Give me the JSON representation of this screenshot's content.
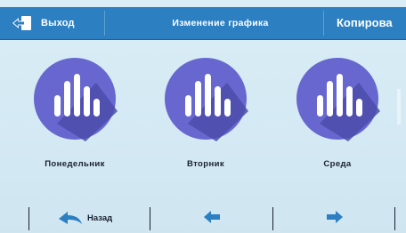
{
  "header": {
    "exit_label": "Выход",
    "title": "Изменение графика",
    "copy_label": "Копирова"
  },
  "days": [
    {
      "label": "Понедельник",
      "icon": "bar-chart-icon"
    },
    {
      "label": "Вторник",
      "icon": "bar-chart-icon"
    },
    {
      "label": "Среда",
      "icon": "bar-chart-icon"
    }
  ],
  "footer": {
    "back_label": "Назад",
    "prev_icon": "arrow-left-icon",
    "next_icon": "arrow-right-icon"
  },
  "colors": {
    "header_bg": "#2c7fc1",
    "circle_main": "#6767cf",
    "circle_shadow": "#4c4caa",
    "background": "#d6ebf4",
    "arrow_blue": "#2c7fc1"
  }
}
